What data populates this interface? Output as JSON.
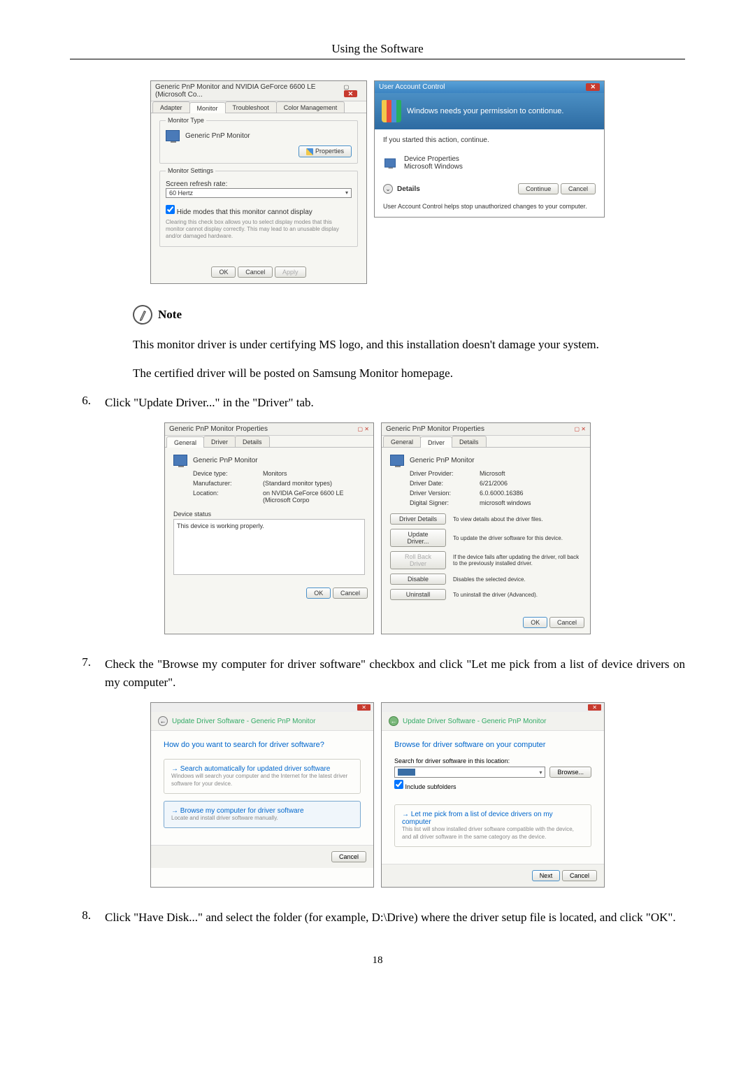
{
  "header": {
    "title": "Using the Software"
  },
  "monitor_props": {
    "window_title": "Generic PnP Monitor and NVIDIA GeForce 6600 LE (Microsoft Co...",
    "tabs": [
      "Adapter",
      "Monitor",
      "Troubleshoot",
      "Color Management"
    ],
    "monitor_type_label": "Monitor Type",
    "monitor_name": "Generic PnP Monitor",
    "properties_btn": "Properties",
    "monitor_settings_label": "Monitor Settings",
    "refresh_label": "Screen refresh rate:",
    "refresh_value": "60 Hertz",
    "hide_modes": "Hide modes that this monitor cannot display",
    "hide_modes_desc": "Clearing this check box allows you to select display modes that this monitor cannot display correctly. This may lead to an unusable display and/or damaged hardware.",
    "ok": "OK",
    "cancel": "Cancel",
    "apply": "Apply"
  },
  "uac": {
    "title": "User Account Control",
    "banner": "Windows needs your permission to contionue.",
    "started": "If you started this action, continue.",
    "device_props": "Device Properties",
    "ms_windows": "Microsoft Windows",
    "details": "Details",
    "continue": "Continue",
    "cancel": "Cancel",
    "helps": "User Account Control helps stop unauthorized changes to your computer."
  },
  "note": {
    "label": "Note",
    "line1": "This monitor driver is under certifying MS logo, and this installation doesn't damage your system.",
    "line2": "The certified driver will be posted on Samsung Monitor homepage."
  },
  "step6": {
    "num": "6.",
    "text": "Click \"Update Driver...\" in the \"Driver\" tab."
  },
  "pnp_general": {
    "title": "Generic PnP Monitor Properties",
    "tabs": [
      "General",
      "Driver",
      "Details"
    ],
    "name": "Generic PnP Monitor",
    "device_type_l": "Device type:",
    "device_type_v": "Monitors",
    "manufacturer_l": "Manufacturer:",
    "manufacturer_v": "(Standard monitor types)",
    "location_l": "Location:",
    "location_v": "on NVIDIA GeForce 6600 LE (Microsoft Corpo",
    "status_l": "Device status",
    "status_v": "This device is working properly.",
    "ok": "OK",
    "cancel": "Cancel"
  },
  "pnp_driver": {
    "title": "Generic PnP Monitor Properties",
    "tabs": [
      "General",
      "Driver",
      "Details"
    ],
    "name": "Generic PnP Monitor",
    "provider_l": "Driver Provider:",
    "provider_v": "Microsoft",
    "date_l": "Driver Date:",
    "date_v": "6/21/2006",
    "version_l": "Driver Version:",
    "version_v": "6.0.6000.16386",
    "signer_l": "Digital Signer:",
    "signer_v": "microsoft windows",
    "btn_details": "Driver Details",
    "btn_details_d": "To view details about the driver files.",
    "btn_update": "Update Driver...",
    "btn_update_d": "To update the driver software for this device.",
    "btn_rollback": "Roll Back Driver",
    "btn_rollback_d": "If the device fails after updating the driver, roll back to the previously installed driver.",
    "btn_disable": "Disable",
    "btn_disable_d": "Disables the selected device.",
    "btn_uninstall": "Uninstall",
    "btn_uninstall_d": "To uninstall the driver (Advanced).",
    "ok": "OK",
    "cancel": "Cancel"
  },
  "step7": {
    "num": "7.",
    "text": "Check the \"Browse my computer for driver software\" checkbox and click \"Let me pick from a list of device drivers on my computer\"."
  },
  "wiz1": {
    "crumb": "Update Driver Software - Generic PnP Monitor",
    "heading": "How do you want to search for driver software?",
    "opt1_t": "Search automatically for updated driver software",
    "opt1_d": "Windows will search your computer and the Internet for the latest driver software for your device.",
    "opt2_t": "Browse my computer for driver software",
    "opt2_d": "Locate and install driver software manually.",
    "cancel": "Cancel"
  },
  "wiz2": {
    "crumb": "Update Driver Software - Generic PnP Monitor",
    "heading": "Browse for driver software on your computer",
    "search_l": "Search for driver software in this location:",
    "browse": "Browse...",
    "include": "Include subfolders",
    "opt_t": "Let me pick from a list of device drivers on my computer",
    "opt_d": "This list will show installed driver software compatible with the device, and all driver software in the same category as the device.",
    "next": "Next",
    "cancel": "Cancel"
  },
  "step8": {
    "num": "8.",
    "text": "Click \"Have Disk...\" and select the folder (for example, D:\\Drive) where the driver setup file is located, and click \"OK\"."
  },
  "page_num": "18"
}
